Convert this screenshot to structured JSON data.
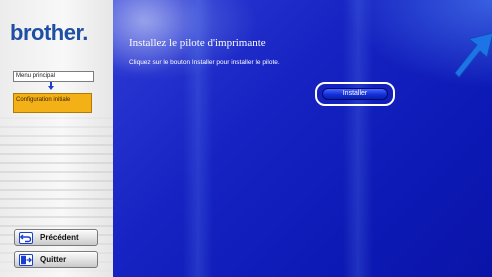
{
  "sidebar": {
    "logo": "brother",
    "logo_dot": ".",
    "menu_principal": "Menu principal",
    "config_initiale": "Configuration initiale",
    "buttons": {
      "prev_label": "Précédent",
      "quit_label": "Quitter"
    },
    "colors": {
      "logo": "#1e4fa3",
      "active_item": "#f3b117"
    }
  },
  "main": {
    "title": "Installez le pilote d'imprimante",
    "instruction": "Cliquez sur le bouton Installer pour installer le pilote.",
    "install_label": "Installer",
    "colors": {
      "background": "#1623c2",
      "pointer_arrow": "#1e73e6"
    }
  },
  "icons": {
    "back": "back-arrow-icon",
    "quit": "exit-door-icon",
    "down": "down-arrow-icon",
    "pointer": "pointer-arrow-icon"
  }
}
